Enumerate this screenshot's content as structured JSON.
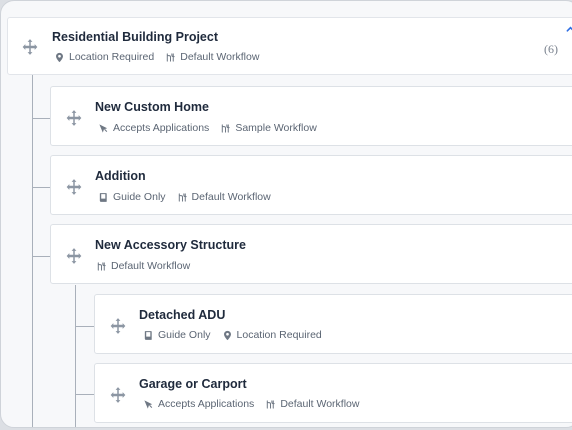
{
  "root": {
    "title": "Residential Building Project",
    "tags": [
      {
        "icon": "location-pin-icon",
        "label": "Location Required"
      },
      {
        "icon": "workflow-icon",
        "label": "Default Workflow"
      }
    ],
    "count": "(6)"
  },
  "children": [
    {
      "title": "New Custom Home",
      "tags": [
        {
          "icon": "cursor-click-icon",
          "label": "Accepts Applications"
        },
        {
          "icon": "workflow-icon",
          "label": "Sample Workflow"
        }
      ]
    },
    {
      "title": "Addition",
      "tags": [
        {
          "icon": "book-icon",
          "label": "Guide Only"
        },
        {
          "icon": "workflow-icon",
          "label": "Default Workflow"
        }
      ]
    },
    {
      "title": "New Accessory Structure",
      "tags": [
        {
          "icon": "workflow-icon",
          "label": "Default Workflow"
        }
      ]
    }
  ],
  "grandchildren": [
    {
      "title": "Detached ADU",
      "tags": [
        {
          "icon": "book-icon",
          "label": "Guide Only"
        },
        {
          "icon": "location-pin-icon",
          "label": "Location Required"
        }
      ]
    },
    {
      "title": "Garage or Carport",
      "tags": [
        {
          "icon": "cursor-click-icon",
          "label": "Accepts Applications"
        },
        {
          "icon": "workflow-icon",
          "label": "Default Workflow"
        }
      ]
    }
  ],
  "colors": {
    "accent": "#2f6fe4",
    "title": "#1f2a3c",
    "meta": "#5b6573",
    "connector": "#a9b0ba"
  }
}
